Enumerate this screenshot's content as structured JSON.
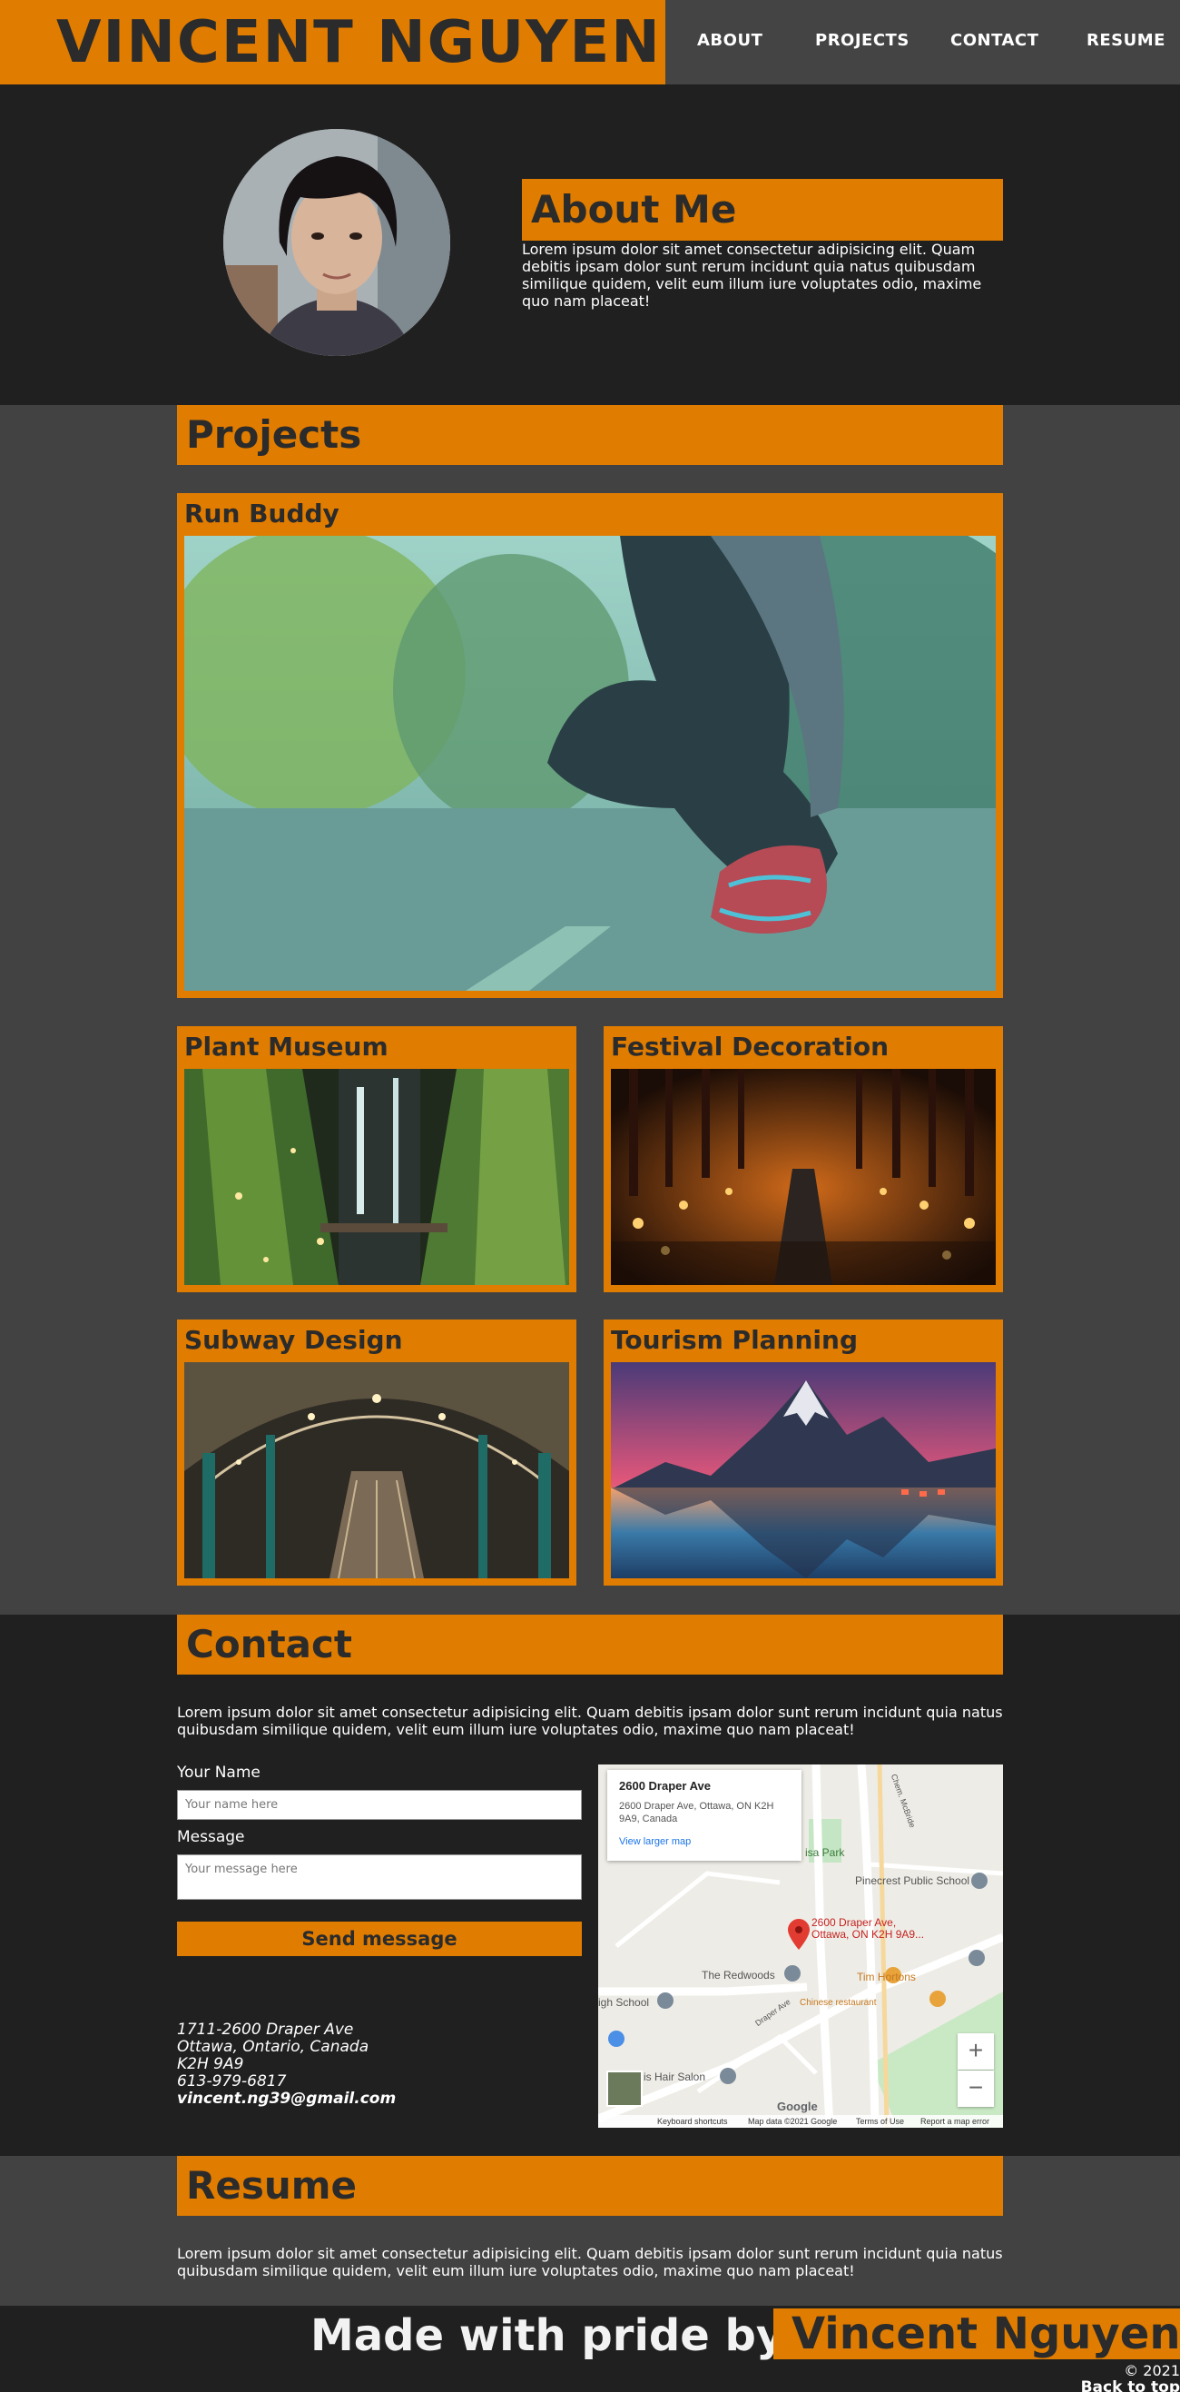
{
  "header": {
    "title": "VINCENT NGUYEN",
    "nav": [
      "ABOUT",
      "PROJECTS",
      "CONTACT",
      "RESUME"
    ]
  },
  "about": {
    "heading": "About Me",
    "text": "Lorem ipsum dolor sit amet consectetur adipisicing elit. Quam debitis ipsam dolor sunt rerum incidunt quia natus quibusdam similique quidem, velit eum illum iure voluptates odio, maxime quo nam placeat!"
  },
  "projects": {
    "heading": "Projects",
    "items": [
      {
        "title": "Run Buddy"
      },
      {
        "title": "Plant Museum"
      },
      {
        "title": "Festival Decoration"
      },
      {
        "title": "Subway Design"
      },
      {
        "title": "Tourism Planning"
      }
    ]
  },
  "contact": {
    "heading": "Contact",
    "intro": "Lorem ipsum dolor sit amet consectetur adipisicing elit. Quam debitis ipsam dolor sunt rerum incidunt quia natus quibusdam similique quidem, velit eum illum iure voluptates odio, maxime quo nam placeat!",
    "name_label": "Your Name",
    "name_placeholder": "Your name here",
    "message_label": "Message",
    "message_placeholder": "Your message here",
    "send_label": "Send message",
    "address": {
      "line1": "1711-2600 Draper Ave",
      "line2": "Ottawa, Ontario, Canada",
      "line3": "K2H 9A9",
      "phone": "613-979-6817",
      "email": "vincent.ng39@gmail.com"
    },
    "map": {
      "place_title": "2600 Draper Ave",
      "place_address": "2600 Draper Ave, Ottawa, ON K2H 9A9, Canada",
      "larger_map": "View larger map",
      "pin_label_1": "2600 Draper Ave,",
      "pin_label_2": "Ottawa, ON K2H 9A9...",
      "labels": {
        "park": "isa Park",
        "school": "Pinecrest Public School",
        "redwoods": "The Redwoods",
        "tims": "Tim Hortons",
        "chinese": "Chinese restaurant",
        "high_school": "igh School",
        "hair": "is Hair Salon",
        "mcbride": "Chem. McBride",
        "draper": "Draper Ave"
      },
      "zoom_in": "+",
      "zoom_out": "−",
      "logo": "Google",
      "footer": [
        "Keyboard shortcuts",
        "Map data ©2021 Google",
        "Terms of Use",
        "Report a map error"
      ]
    }
  },
  "resume": {
    "heading": "Resume",
    "text": "Lorem ipsum dolor sit amet consectetur adipisicing elit. Quam debitis ipsam dolor sunt rerum incidunt quia natus quibusdam similique quidem, velit eum illum iure voluptates odio, maxime quo nam placeat!"
  },
  "footer": {
    "made_with": "Made with pride by",
    "name": "Vincent Nguyen",
    "copyright": "© 2021",
    "back_to_top": "Back to top"
  },
  "colors": {
    "accent": "#e07c00",
    "dark_bg": "#202020",
    "mid_bg": "#424242"
  }
}
